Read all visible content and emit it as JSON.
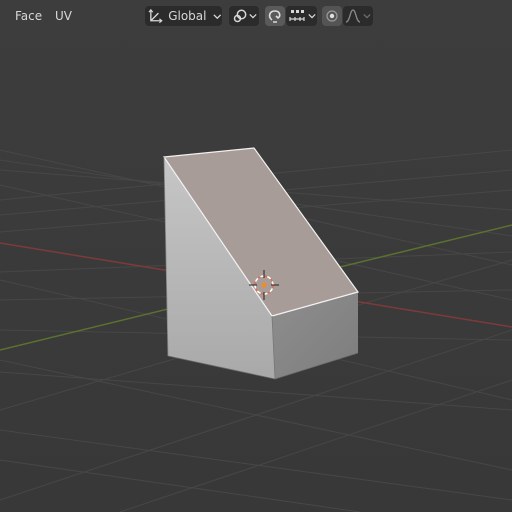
{
  "header": {
    "menus": [
      {
        "label": "Face"
      },
      {
        "label": "UV"
      }
    ],
    "transform_orientation": {
      "icon": "transform-orientation-icon",
      "value": "Global"
    },
    "pivot": {
      "icon": "link-chain-icon"
    },
    "snap": {
      "icon": "magnet-snap-icon",
      "target_icon": "snap-increment-icon"
    },
    "proportional_edit": {
      "icon": "proportional-dot-icon",
      "falloff_icon": "falloff-curve-icon"
    }
  },
  "viewport": {
    "background_color": "#3a3a3a",
    "grid_color": "#484848",
    "x_axis_color": "#8a3b3b",
    "y_axis_color": "#5e7a2e",
    "object": {
      "type": "wedge-mesh",
      "selected_face_color": "#a79b98",
      "side_color": "#b5b5b5"
    }
  }
}
